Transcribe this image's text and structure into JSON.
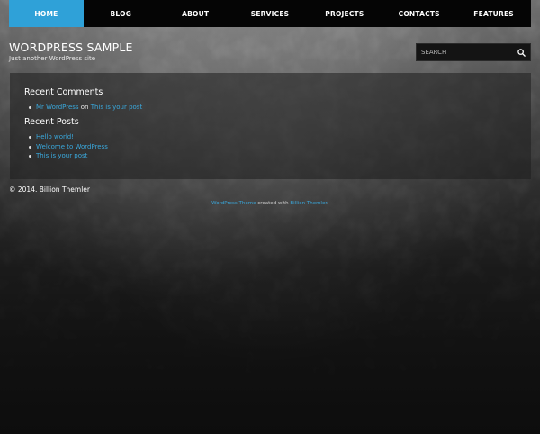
{
  "nav": {
    "items": [
      {
        "label": "HOME",
        "active": true
      },
      {
        "label": "BLOG",
        "active": false
      },
      {
        "label": "ABOUT",
        "active": false
      },
      {
        "label": "SERVICES",
        "active": false
      },
      {
        "label": "PROJECTS",
        "active": false
      },
      {
        "label": "CONTACTS",
        "active": false
      },
      {
        "label": "FEATURES",
        "active": false
      }
    ]
  },
  "header": {
    "title": "WORDPRESS SAMPLE",
    "tagline": "Just another WordPress site"
  },
  "search": {
    "placeholder": "SEARCH",
    "icon": "search-icon"
  },
  "widgets": {
    "recent_comments": {
      "title": "Recent Comments",
      "items": [
        {
          "author": "Mr WordPress",
          "connector": "on",
          "post": "This is your post"
        }
      ]
    },
    "recent_posts": {
      "title": "Recent Posts",
      "items": [
        "Hello world!",
        "Welcome to WordPress",
        "This is your post"
      ]
    }
  },
  "footer": {
    "copyright": "© 2014. Billion Themler",
    "credit_link1": "WordPress Theme",
    "credit_middle": " created with ",
    "credit_link2": "Billion Themler",
    "credit_end": "."
  },
  "colors": {
    "accent": "#2fa1d8",
    "link": "#3aa8dc",
    "nav_bg": "#050505"
  }
}
